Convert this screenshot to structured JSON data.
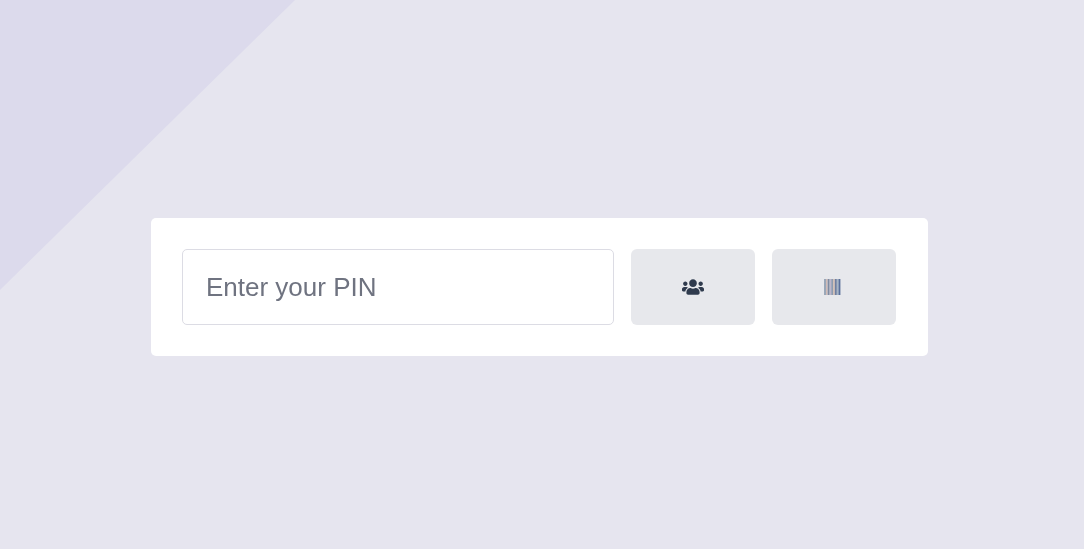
{
  "pin_field": {
    "placeholder": "Enter your PIN"
  },
  "buttons": [
    {
      "kind": "users"
    },
    {
      "kind": "barcode"
    }
  ]
}
